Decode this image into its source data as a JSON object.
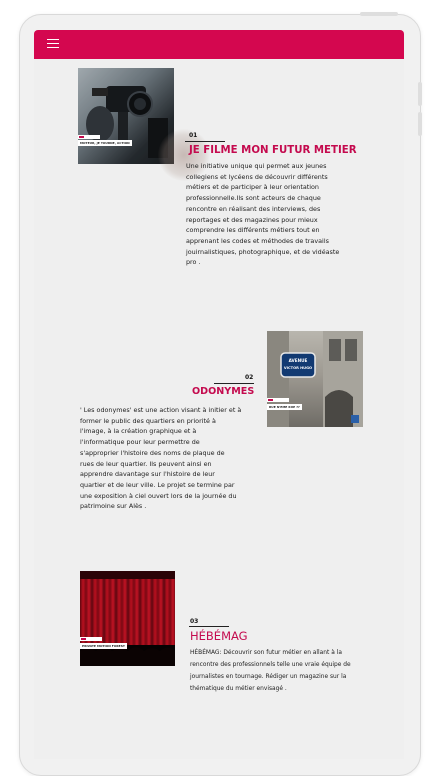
{
  "colors": {
    "brand": "#d4074f",
    "title": "#c40a4e",
    "background": "#efefef"
  },
  "nav": {
    "menu_icon": "hamburger-menu-icon"
  },
  "projects": [
    {
      "number": "01",
      "title": "JE FILME MON FUTUR METIER",
      "thumb_tag": "MOTEUR, JE TOURNE, ACTION",
      "description": "Une initiative unique qui permet aux jeunes\ncollegiens et lycéens de découvrir différents\nmétiers et de participer à leur orientation\nprofessionnelle.Ils sont acteurs de chaque\nrencontre en réalisant des interviews, des\nreportages et des magazines pour mieux\ncomprendre les différents métiers tout en\napprenant les codes et méthodes de travails\njouirnalistiques, photographique, et de vidéaste\npro ."
    },
    {
      "number": "02",
      "title": "ODONYMES",
      "thumb_tag": "RUE N'EME RUE ??",
      "sign_text": "AVENUE VICTOR HUGO",
      "description": "' Les odonymes' est une action visant à initier et à\nformer le public des quartiers en priorité à\nl'image, à la création graphique et à\nl'informatique pour leur permettre de\ns'approprier l'histoire des noms de plaque de\nrues de leur quartier. Ils peuvent ainsi en\napprendre davantage sur l'histoire de leur\nquartier et de leur ville. Le projet se termine par\nune exposition à ciel ouvert lors de la journée du\npatrimoine sur Alès ."
    },
    {
      "number": "03",
      "title": "HÉBÉMAG",
      "thumb_tag": "PRIVATE MOTION FOREST",
      "description": "HÉBÉMAG: Découvrir son futur métier en allant à la\nrencontre des professionnels telle une vraie équipe de\njournalistes en tournage. Rédiger un magazine sur la\nthématique du métier envisagé ."
    }
  ]
}
